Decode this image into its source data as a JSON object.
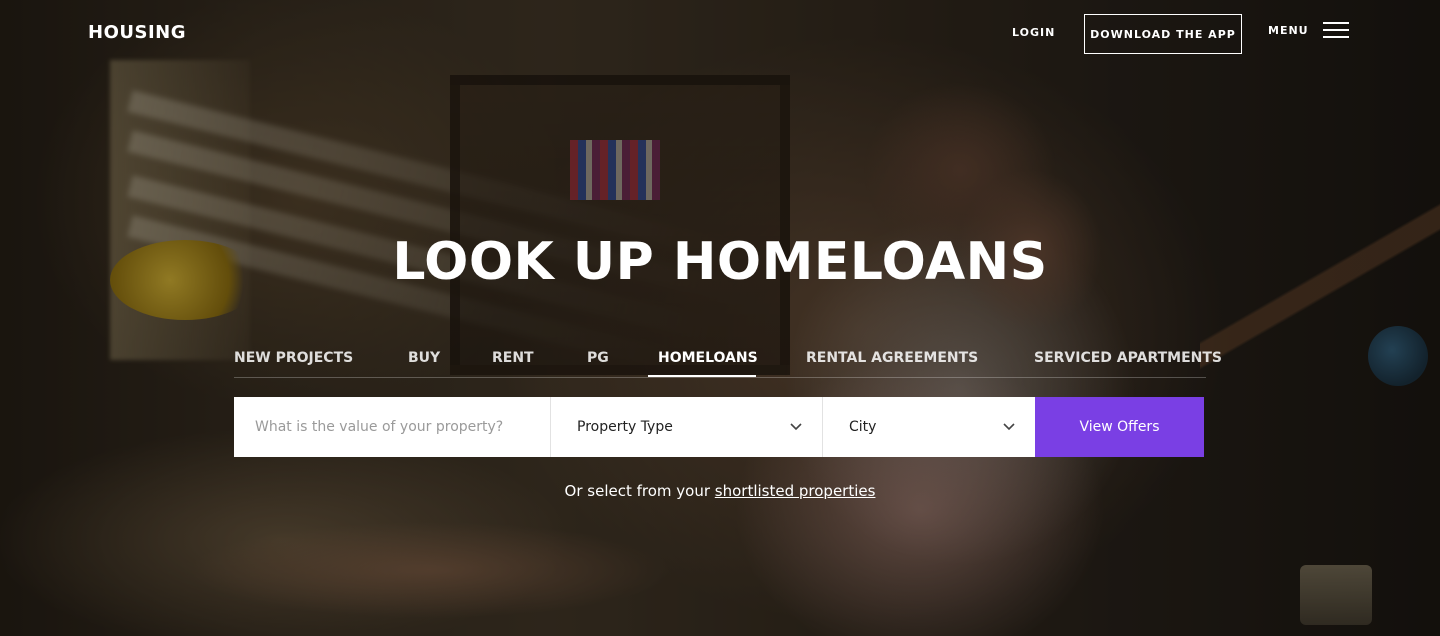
{
  "header": {
    "logo": "HOUSING",
    "login_label": "LOGIN",
    "download_label": "DOWNLOAD THE APP",
    "menu_label": "MENU"
  },
  "hero": {
    "headline": "LOOK UP HOMELOANS"
  },
  "tabs": [
    {
      "label": "NEW PROJECTS",
      "active": false
    },
    {
      "label": "BUY",
      "active": false
    },
    {
      "label": "RENT",
      "active": false
    },
    {
      "label": "PG",
      "active": false
    },
    {
      "label": "HOMELOANS",
      "active": true
    },
    {
      "label": "RENTAL AGREEMENTS",
      "active": false
    },
    {
      "label": "SERVICED APARTMENTS",
      "active": false
    }
  ],
  "search": {
    "value_placeholder": "What is the value of your property?",
    "property_type_label": "Property Type",
    "city_label": "City",
    "submit_label": "View Offers"
  },
  "shortlist": {
    "prefix": "Or select from your",
    "link_label": "shortlisted properties"
  },
  "icons": {
    "menu": "hamburger-icon",
    "dropdown": "chevron-down-icon"
  },
  "colors": {
    "accent": "#7a3fe4",
    "text_on_dark": "#ffffff"
  }
}
